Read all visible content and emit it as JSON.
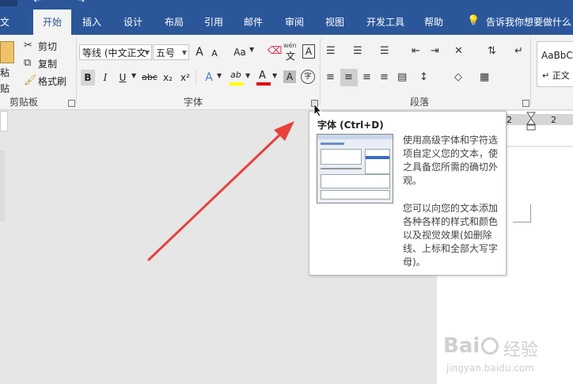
{
  "tabs": {
    "file": "文件",
    "home": "开始",
    "insert": "插入",
    "design": "设计",
    "layout": "布局",
    "references": "引用",
    "mailings": "邮件",
    "review": "审阅",
    "view": "视图",
    "developer": "开发工具",
    "help": "帮助",
    "tell_me": "告诉我你想要做什么"
  },
  "clipboard": {
    "paste": "粘贴",
    "cut": "剪切",
    "copy": "复制",
    "format_painter": "格式刷",
    "label": "剪贴板"
  },
  "font": {
    "font_name": "等线 (中文正文",
    "font_size": "五号",
    "bold": "B",
    "italic": "I",
    "underline": "U",
    "strike": "abc",
    "subscript": "x₂",
    "superscript": "x²",
    "grow": "A",
    "shrink": "A",
    "case": "Aa",
    "phonetic": "wén",
    "phonetic_char": "文",
    "border_char": "A",
    "text_effect": "A",
    "highlight": "ab",
    "font_color": "A",
    "char_shading": "A",
    "enclose": "字",
    "label": "字体"
  },
  "paragraph": {
    "label": "段落"
  },
  "styles": {
    "preview": "AaBbC",
    "normal": "↵ 正文"
  },
  "ruler": {
    "left_num": "2",
    "right_num": "2"
  },
  "tooltip": {
    "title": "字体 (Ctrl+D)",
    "para1": "使用高级字体和字符选项自定义您的文本，使之具备您所需的确切外观。",
    "para2": "您可以向您的文本添加各种各样的样式和颜色以及视觉效果(如删除线、上标和全部大写字母)。"
  },
  "watermark": {
    "brand": "Bai",
    "brand2": "经验",
    "url": "jingyan.baidu.com"
  },
  "colors": {
    "accent": "#2b579a",
    "arrow": "#e8413c",
    "highlight_yellow": "#ffff00",
    "font_red": "#e00000"
  }
}
